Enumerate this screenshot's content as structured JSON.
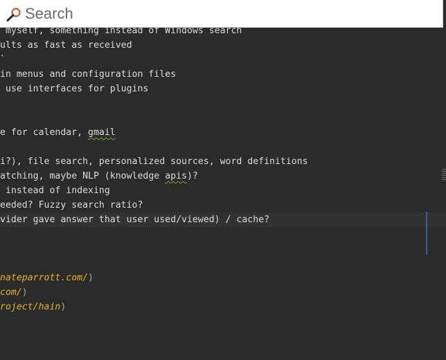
{
  "search": {
    "placeholder": "Search",
    "value": ""
  },
  "editor": {
    "lines": [
      " myself, something instead of Windows search",
      "ults as fast as received",
      "`",
      "in menus and configuration files",
      " use interfaces for plugins",
      "",
      "",
      "e for calendar, gmail",
      "",
      "i?), file search, personalized sources, word definitions",
      "atching, maybe NLP (knowledge apis)?",
      " instead of indexing",
      "eeded? Fuzzy search ratio?",
      "vider gave answer that user used/viewed) / cache?",
      "",
      "",
      "nateparrott.com/)",
      "com/)",
      "roject/hain)"
    ],
    "line7": {
      "prefix": "e for calendar, ",
      "squiggle": "gmail"
    },
    "line10": {
      "prefix": "atching, maybe NLP (knowledge ",
      "squiggle": "apis",
      "suffix": ")?"
    },
    "links": [
      {
        "text": "nateparrott.com/",
        "close": ")"
      },
      {
        "text": "com/",
        "close": ")"
      },
      {
        "text": "roject/hain",
        "close": ")"
      }
    ]
  },
  "colors": {
    "editor_bg": "#2b2b2b",
    "text": "#dcdcdc",
    "link": "#e6b422",
    "spell_squiggle": "#6ea84a",
    "search_bg": "#ffffff",
    "search_icon": "#d9542b"
  },
  "icons": {
    "search": "search-icon"
  }
}
